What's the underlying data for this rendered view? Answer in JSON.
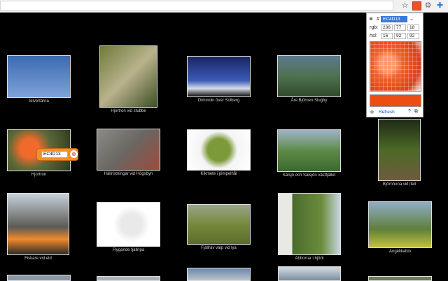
{
  "toolbar": {
    "star_icon": "star-icon",
    "extension_icons": [
      "colorzilla-extension-icon",
      "settings-extension-icon",
      "puzzle-extension-icon"
    ]
  },
  "gallery": {
    "items": [
      {
        "caption": "Silvertärna"
      },
      {
        "caption": "Hjortron vid stubbe"
      },
      {
        "caption": "Dimmoln över Solberg"
      },
      {
        "caption": "Åre Björnen Slugby"
      },
      {
        "caption": "Hjortron"
      },
      {
        "caption": "Hällristningar vid Högsbyn"
      },
      {
        "caption": "Kikmete i pimpelhål"
      },
      {
        "caption": "Sälsjö och Sälsjön västfjället"
      },
      {
        "caption": "Björnhona vid ifell"
      },
      {
        "caption": "Fiskare vid eld"
      },
      {
        "caption": "Flygande fjällripa"
      },
      {
        "caption": "Fjällräv valp vid lya"
      },
      {
        "caption": "Abborrar i björk"
      },
      {
        "caption": "Angelikablo"
      }
    ]
  },
  "picker": {
    "hex_label": "#",
    "hex_value": "EC4D13",
    "rgb_label": "rgb:",
    "rgb": [
      "236",
      "77",
      "18"
    ],
    "hsl_label": "hsl:",
    "hsl": [
      "16",
      "92",
      "92"
    ],
    "refresh_label": "Refresh",
    "help_label": "?",
    "swatch_color": "#ec4d13"
  },
  "tag": {
    "value": "EC4D13"
  }
}
